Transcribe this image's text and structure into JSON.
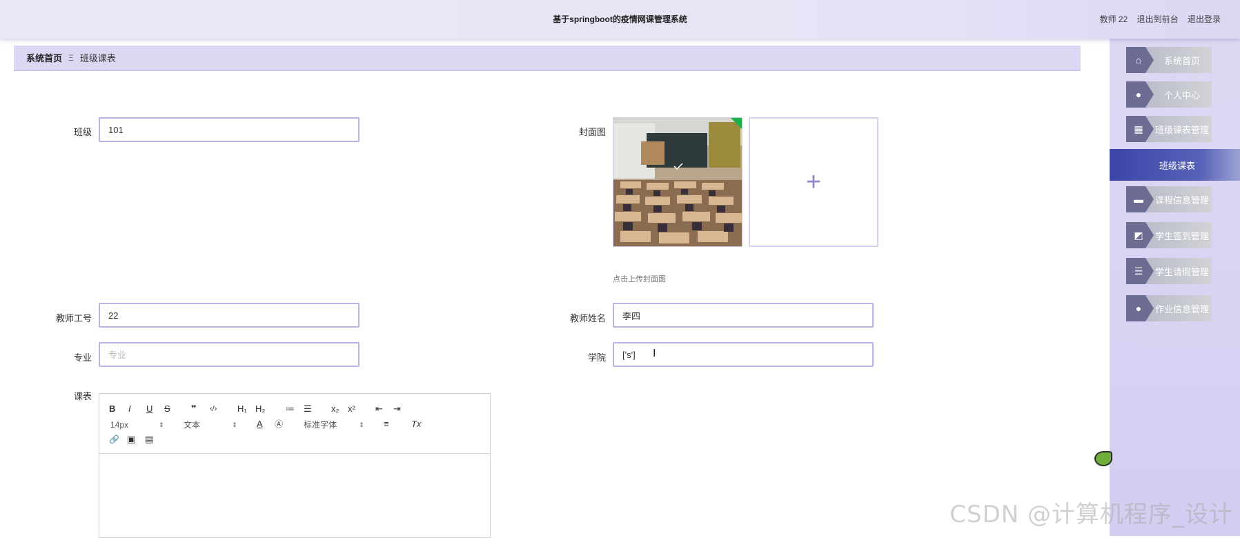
{
  "header": {
    "title": "基于springboot的疫情网课管理系统",
    "user_label": "教师 22",
    "front_link": "退出到前台",
    "logout_link": "退出登录"
  },
  "breadcrumb": {
    "home": "系统首页",
    "separator": "Ξ",
    "current": "班级课表"
  },
  "sidebar": {
    "items": [
      {
        "label": "系统首页",
        "icon": "home-icon",
        "glyph": "⌂"
      },
      {
        "label": "个人中心",
        "icon": "user-icon",
        "glyph": "●"
      },
      {
        "label": "班级课表管理",
        "icon": "grid-icon",
        "glyph": "▦"
      },
      {
        "label": "班级课表",
        "icon": "",
        "glyph": ""
      },
      {
        "label": "课程信息管理",
        "icon": "briefcase-icon",
        "glyph": "▬"
      },
      {
        "label": "学生签到管理",
        "icon": "chart-icon",
        "glyph": "◩"
      },
      {
        "label": "学生请假管理",
        "icon": "list-icon",
        "glyph": "☰"
      },
      {
        "label": "作业信息管理",
        "icon": "bulb-icon",
        "glyph": "●"
      }
    ]
  },
  "form": {
    "class": {
      "label": "班级",
      "value": "101"
    },
    "cover": {
      "label": "封面图",
      "hint": "点击上传封面图",
      "upload_symbol": "+"
    },
    "teacher_id": {
      "label": "教师工号",
      "value": "22"
    },
    "teacher_name": {
      "label": "教师姓名",
      "value": "李四"
    },
    "major": {
      "label": "专业",
      "placeholder": "专业",
      "value": ""
    },
    "college": {
      "label": "学院",
      "value": "['s']"
    },
    "schedule": {
      "label": "课表"
    }
  },
  "editor": {
    "buttons": [
      "B",
      "I",
      "U",
      "S",
      "❞",
      "‹/›",
      "H₁",
      "H₂",
      "≔",
      "☰",
      "x₂",
      "x²",
      "⇤",
      "⇥",
      "A",
      "Ⓐ",
      "≡",
      "Tx",
      "🔗",
      "▣",
      "▤"
    ],
    "font_size": "14px",
    "format": "文本",
    "font_family": "标准字体"
  },
  "watermark": "CSDN @计算机程序_设计"
}
